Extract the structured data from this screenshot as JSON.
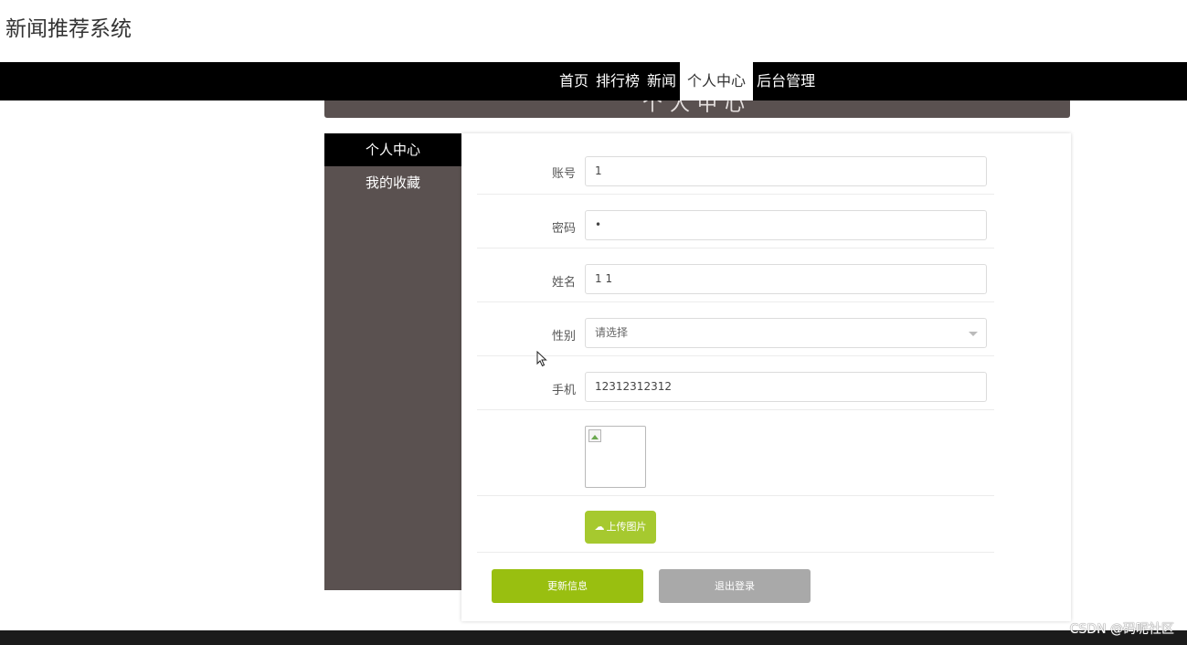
{
  "site_title": "新闻推荐系统",
  "nav": {
    "items": [
      {
        "label": "首页",
        "active": false
      },
      {
        "label": "排行榜",
        "active": false
      },
      {
        "label": "新闻",
        "active": false
      },
      {
        "label": "个人中心",
        "active": true
      },
      {
        "label": "后台管理",
        "active": false
      }
    ]
  },
  "banner": {
    "ghost_text": "个人中心"
  },
  "sidebar": {
    "items": [
      {
        "label": "个人中心",
        "active": true
      },
      {
        "label": "我的收藏",
        "active": false
      }
    ]
  },
  "form": {
    "account": {
      "label": "账号",
      "value": "1"
    },
    "password": {
      "label": "密码",
      "value": "•"
    },
    "name": {
      "label": "姓名",
      "value": "1 1"
    },
    "gender": {
      "label": "性别",
      "value": "请选择"
    },
    "phone": {
      "label": "手机",
      "value": "12312312312"
    },
    "upload_label": "上传图片",
    "upload_icon": "cloud-upload-icon"
  },
  "buttons": {
    "update": "更新信息",
    "logout": "退出登录"
  },
  "watermark": "CSDN @码呢社区",
  "colors": {
    "nav_bg": "#000000",
    "sidebar_bg": "#5a5150",
    "upload_green": "#a6c92f",
    "update_green": "#99bf10",
    "logout_grey": "#a9a9a9"
  }
}
